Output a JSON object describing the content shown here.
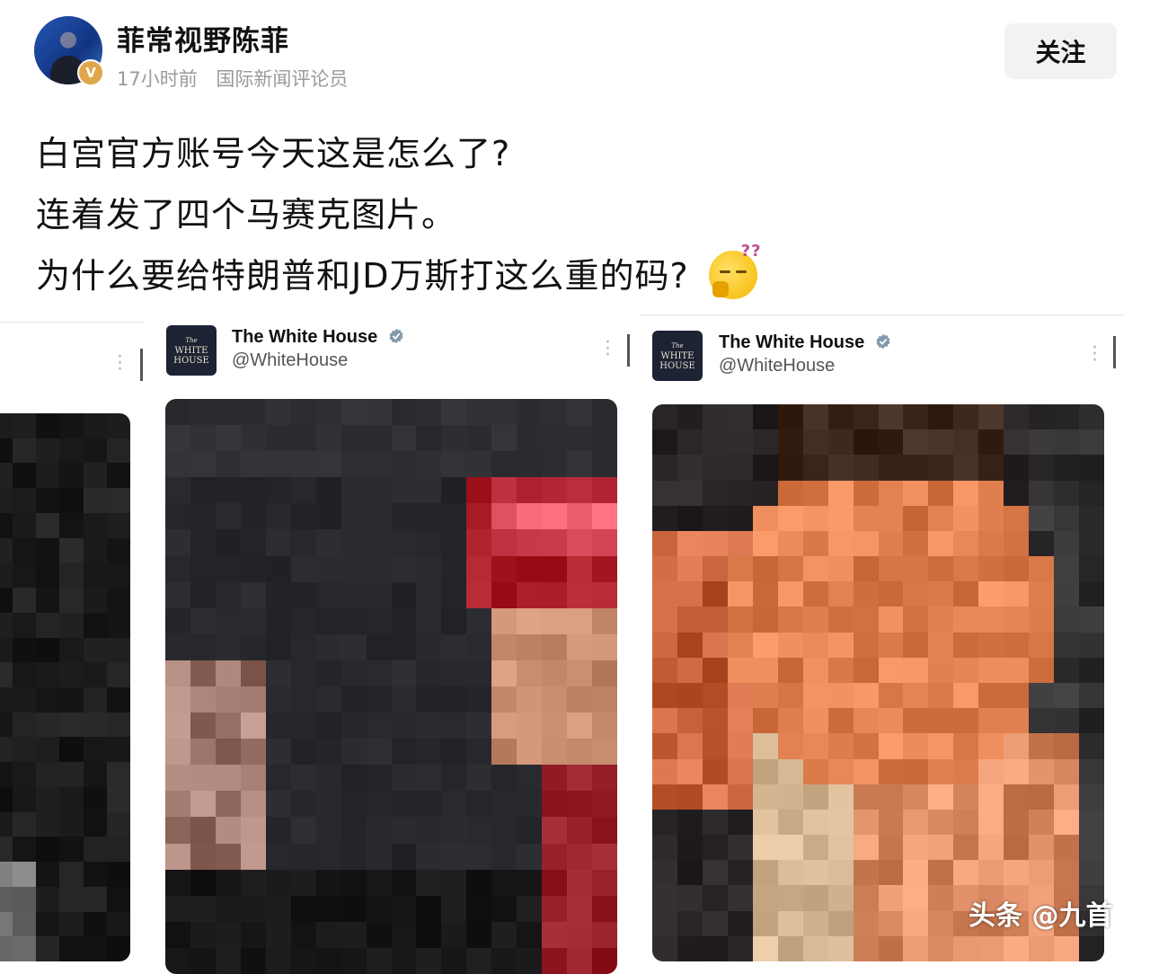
{
  "header": {
    "author_name": "菲常视野陈菲",
    "badge": "V",
    "time": "17小时前",
    "role": "国际新闻评论员",
    "follow_label": "关注"
  },
  "post": {
    "lines": [
      "白宫官方账号今天这是怎么了?",
      "连着发了四个马赛克图片。",
      "为什么要给特朗普和JD万斯打这么重的码?"
    ],
    "emoji_icon": "sleepy-thinking-emoji"
  },
  "tweets": [
    {
      "account_name": "The White House",
      "handle": "@WhiteHouse",
      "logo_text_small": "The",
      "logo_text_line1": "WHITE",
      "logo_text_line2": "HOUSE"
    },
    {
      "account_name": "The White House",
      "handle": "@WhiteHouse",
      "logo_text_small": "The",
      "logo_text_line1": "WHITE",
      "logo_text_line2": "HOUSE"
    }
  ],
  "watermark": "头条 @九首",
  "colors": {
    "accent_badge": "#e0a64a",
    "verified": "#829aab",
    "follow_bg": "#f2f2f2"
  }
}
